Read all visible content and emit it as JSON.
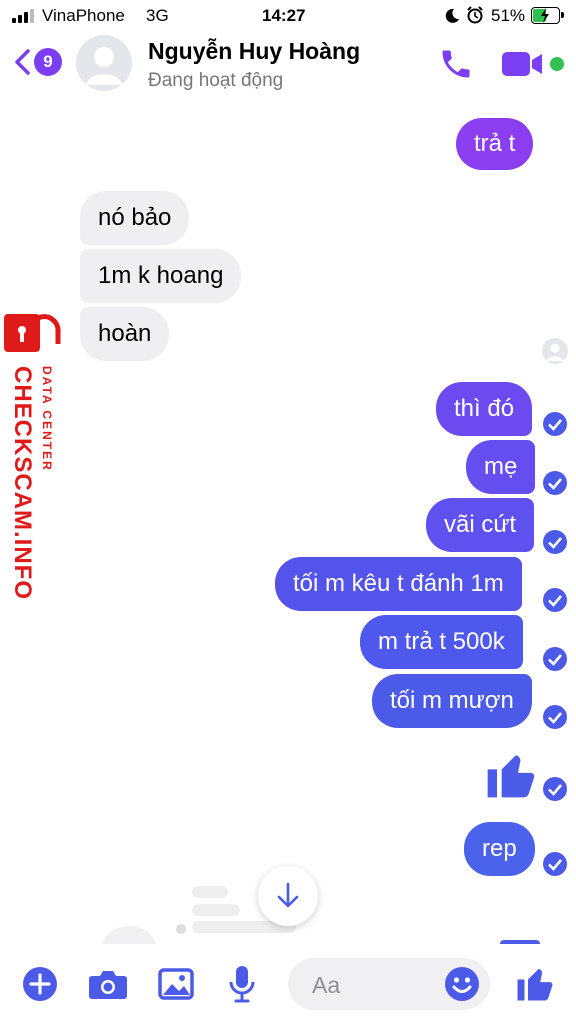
{
  "status": {
    "carrier": "VinaPhone",
    "network": "3G",
    "time": "14:27",
    "battery": "51%"
  },
  "header": {
    "unread_count": "9",
    "contact_name": "Nguyễn Huy Hoàng",
    "contact_status": "Đang hoạt động"
  },
  "messages": {
    "m1": "trả t",
    "m2": "nó bảo",
    "m3": "1m k hoang",
    "m4": "hoàn",
    "m5": "thì đó",
    "m6": "mẹ",
    "m7": "vãi cứt",
    "m8": "tối m kêu t đánh 1m",
    "m9": "m trả t 500k",
    "m10": "tối m mượn",
    "m11": "rep"
  },
  "watermark": {
    "brand": "CHECKSCAM.INFO",
    "sub": "DATA CENTER"
  },
  "composer": {
    "placeholder": "Aa"
  },
  "colors": {
    "accent": "#7b3ff2",
    "bubble_purple": "#8a3ef0",
    "bubble_blue": "#4b5be8",
    "incoming": "#efeff1",
    "online": "#30c04f",
    "watermark_red": "#e01919"
  }
}
